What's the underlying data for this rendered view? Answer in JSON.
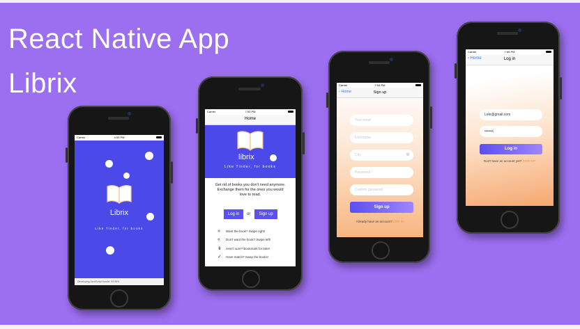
{
  "headline": {
    "line1": "React Native App",
    "line2": "Librix"
  },
  "status": {
    "carrier": "Carrier",
    "time1": "4:59 PM",
    "time2": "7:53 PM",
    "time3": "7:54 PM",
    "time4": "7:55 PM"
  },
  "splash": {
    "app_name": "Librix",
    "tagline": "Like Tinder, for books",
    "footer": "Developing JavaScript bundle: 99.98%"
  },
  "home": {
    "nav_title": "Home",
    "logo_text": "librix",
    "tagline": "Like Tinder, for books",
    "description": "Get rid of books you don't need anymore. Exchange them for the ones you would love to read.",
    "login_label": "Log in",
    "or_label": "or",
    "signup_label": "Sign up",
    "tips": [
      {
        "icon": "»",
        "text": "Want the book? Swipe right!"
      },
      {
        "icon": "«",
        "text": "Don't want the book? Swipe left!"
      },
      {
        "icon": "↡",
        "text": "Aren't sure? Bookmark for later!"
      },
      {
        "icon": "✓",
        "text": "Have match? Swap the books!"
      }
    ]
  },
  "signup": {
    "back_label": "Home",
    "nav_title": "Sign up",
    "fields": [
      {
        "placeholder": "Your email"
      },
      {
        "placeholder": "Username"
      },
      {
        "placeholder": "City"
      },
      {
        "placeholder": "Password"
      },
      {
        "placeholder": "Confirm password"
      }
    ],
    "button_label": "Sign up",
    "footer_text": "Already have an account?",
    "footer_link": "LOG IN"
  },
  "login": {
    "back_label": "Home",
    "nav_title": "Log in",
    "email_value": "Lele@gmail.com",
    "password_value": "•••••••",
    "button_label": "Log in",
    "footer_text": "Don't have an account yet?",
    "footer_link": "SIGN UP"
  },
  "colors": {
    "bg": "#9c6ef0",
    "brand": "#4b4ae8",
    "button_start": "#5a4ff0",
    "button_end": "#9f86ff",
    "link": "#ff8a3d"
  }
}
